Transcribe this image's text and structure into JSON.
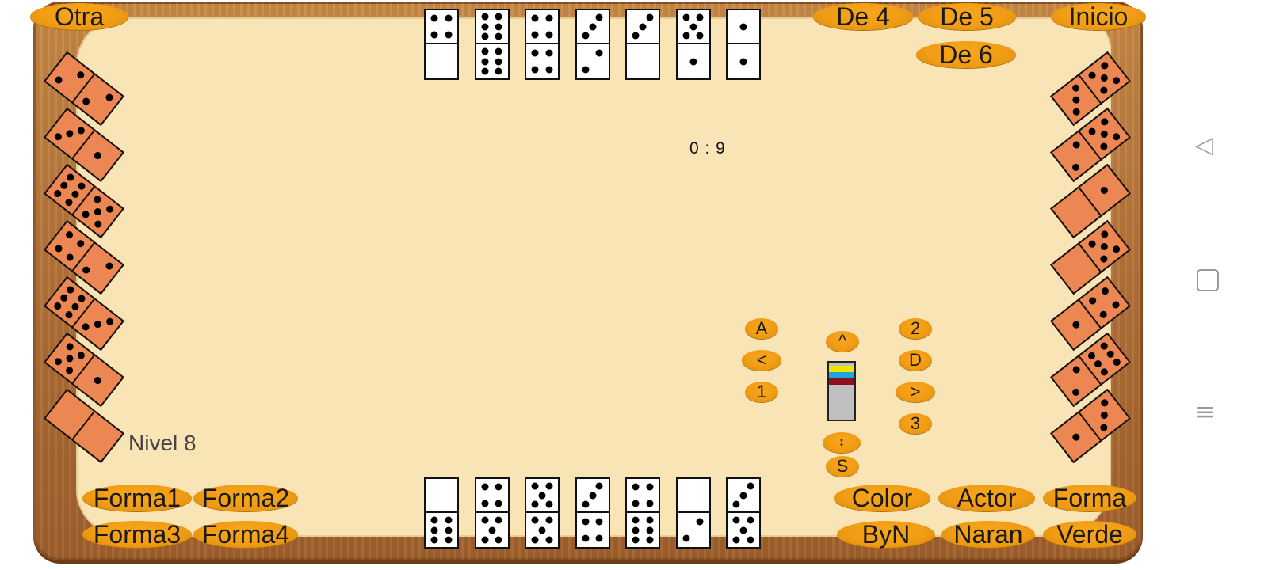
{
  "buttons": {
    "otra": "Otra",
    "de4": "De 4",
    "de5": "De 5",
    "de6": "De 6",
    "inicio": "Inicio",
    "forma1": "Forma1",
    "forma2": "Forma2",
    "forma3": "Forma3",
    "forma4": "Forma4",
    "color": "Color",
    "actor": "Actor",
    "forma": "Forma",
    "byn": "ByN",
    "naran": "Naran",
    "verde": "Verde"
  },
  "controls": {
    "a": "A",
    "lt": "<",
    "one": "1",
    "up": "^",
    "two": "2",
    "d": "D",
    "gt": ">",
    "three": "3",
    "vert": "↕",
    "s": "S"
  },
  "score": "0 : 9",
  "level": "Nivel 8",
  "colors": {
    "strip": [
      "#f4e300",
      "#1aa7e0",
      "#8b1020"
    ]
  },
  "dominoes": {
    "top": [
      [
        4,
        0
      ],
      [
        6,
        6
      ],
      [
        4,
        4
      ],
      [
        3,
        2
      ],
      [
        3,
        0
      ],
      [
        5,
        1
      ],
      [
        1,
        1
      ]
    ],
    "bottom": [
      [
        0,
        6
      ],
      [
        4,
        5
      ],
      [
        5,
        5
      ],
      [
        3,
        4
      ],
      [
        4,
        6
      ],
      [
        0,
        2
      ],
      [
        3,
        5
      ]
    ],
    "left": [
      [
        2,
        2
      ],
      [
        3,
        1
      ],
      [
        6,
        5
      ],
      [
        4,
        2
      ],
      [
        6,
        3
      ],
      [
        5,
        1
      ],
      [
        0,
        0
      ]
    ],
    "right": [
      [
        3,
        5
      ],
      [
        2,
        5
      ],
      [
        0,
        1
      ],
      [
        0,
        5
      ],
      [
        1,
        4
      ],
      [
        2,
        6
      ],
      [
        1,
        3
      ]
    ]
  },
  "system_nav": [
    "back-icon",
    "home-icon",
    "menu-icon"
  ]
}
